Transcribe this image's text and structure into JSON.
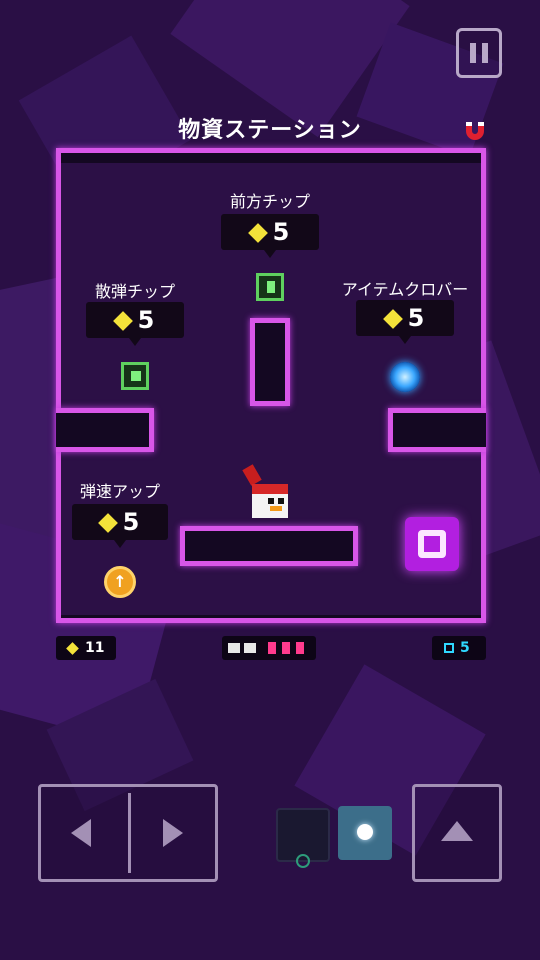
{
  "title": "物資ステーション",
  "colors": {
    "accent": "#d856e8",
    "gem": "#f3e23a",
    "background": "#2a0f45"
  },
  "items": [
    {
      "label": "前方チップ",
      "price": "5",
      "icon": "forward-chip-icon"
    },
    {
      "label": "散弾チップ",
      "price": "5",
      "icon": "spread-chip-icon"
    },
    {
      "label": "アイテムクロバー",
      "price": "5",
      "icon": "item-orb-icon"
    },
    {
      "label": "弾速アップ",
      "price": "5",
      "icon": "bullet-speed-coin-icon"
    }
  ],
  "coin_item_glyph": "↑",
  "hud": {
    "gems": "11",
    "keys": "5",
    "health_pips": 3
  },
  "controls": {
    "left_icon": "left-arrow-icon",
    "right_icon": "right-arrow-icon",
    "jump_icon": "jump-arrow-icon",
    "pause_icon": "pause-icon"
  }
}
